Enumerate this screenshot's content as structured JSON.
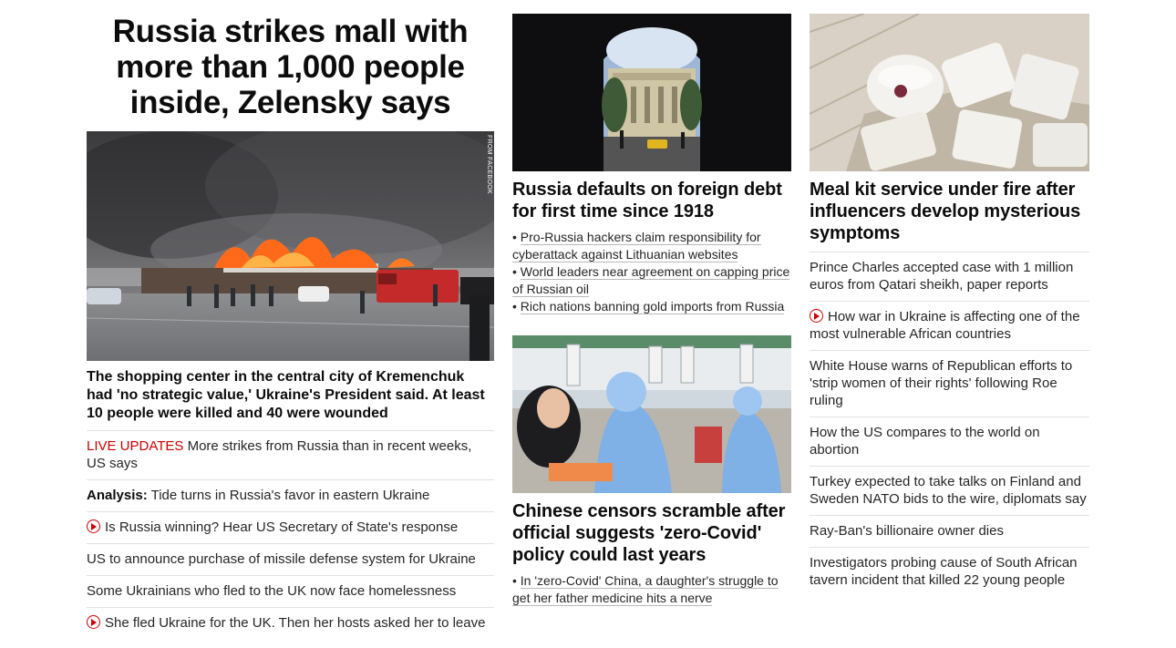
{
  "lead": {
    "title": "Russia strikes mall with more than 1,000 people inside, Zelensky says",
    "image_credit": "FROM FACEBOOK",
    "dek": "The shopping center in the central city of Kremenchuk had 'no strategic value,' Ukraine's President said. At least 10 people were killed and 40 were wounded",
    "items": [
      {
        "tag": "LIVE UPDATES",
        "text": "More strikes from Russia than in recent weeks, US says"
      },
      {
        "tag": "Analysis:",
        "text": "Tide turns in Russia's favor in eastern Ukraine"
      },
      {
        "video": true,
        "text": "Is Russia winning? Hear US Secretary of State's response"
      },
      {
        "text": "US to announce purchase of missile defense system for Ukraine"
      },
      {
        "text": "Some Ukrainians who fled to the UK now face homelessness"
      },
      {
        "video": true,
        "text": "She fled Ukraine for the UK. Then her hosts asked her to leave"
      }
    ]
  },
  "middle": {
    "card1": {
      "title": "Russia defaults on foreign debt for first time since 1918",
      "bullets": [
        "Pro-Russia hackers claim responsibility for cyberattack against Lithuanian websites",
        "World leaders near agreement on capping price of Russian oil",
        "Rich nations banning gold imports from Russia"
      ]
    },
    "card2": {
      "title": "Chinese censors scramble after official suggests 'zero-Covid' policy could last years",
      "bullets": [
        "In 'zero-Covid' China, a daughter's struggle to get her father medicine hits a nerve"
      ]
    }
  },
  "right": {
    "card": {
      "title": "Meal kit service under fire after influencers develop mysterious symptoms"
    },
    "items": [
      {
        "text": "Prince Charles accepted case with 1 million euros from Qatari sheikh, paper reports"
      },
      {
        "video": true,
        "text": "How war in Ukraine is affecting one of the most vulnerable African countries"
      },
      {
        "text": "White House warns of Republican efforts to 'strip women of their rights' following Roe ruling"
      },
      {
        "text": "How the US compares to the world on abortion"
      },
      {
        "text": "Turkey expected to take talks on Finland and Sweden NATO bids to the wire, diplomats say"
      },
      {
        "text": "Ray-Ban's billionaire owner dies"
      },
      {
        "text": "Investigators probing cause of South African tavern incident that killed 22 young people"
      }
    ]
  },
  "colors": {
    "live": "#cc0000",
    "text": "#262626",
    "divider": "#e2e2e2"
  },
  "icons": {
    "video": "play-circle-icon"
  }
}
